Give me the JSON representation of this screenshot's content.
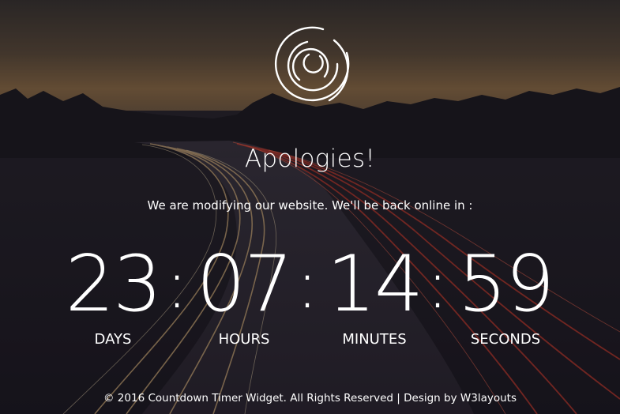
{
  "page": {
    "heading": "Apologies!",
    "message": "We are modifying our website. We'll be back online in :"
  },
  "countdown": {
    "separator": ":",
    "units": [
      {
        "value": "23",
        "label": "DAYS"
      },
      {
        "value": "07",
        "label": "HOURS"
      },
      {
        "value": "14",
        "label": "MINUTES"
      },
      {
        "value": "59",
        "label": "SECONDS"
      }
    ]
  },
  "footer": {
    "copyright": "© 2016 Countdown Timer Widget. All Rights Reserved | Design by ",
    "link_text": "W3layouts"
  },
  "logo": {
    "icon": "concentric-circles-icon"
  },
  "colors": {
    "text": "#ffffff",
    "background": "#1c1a24"
  }
}
